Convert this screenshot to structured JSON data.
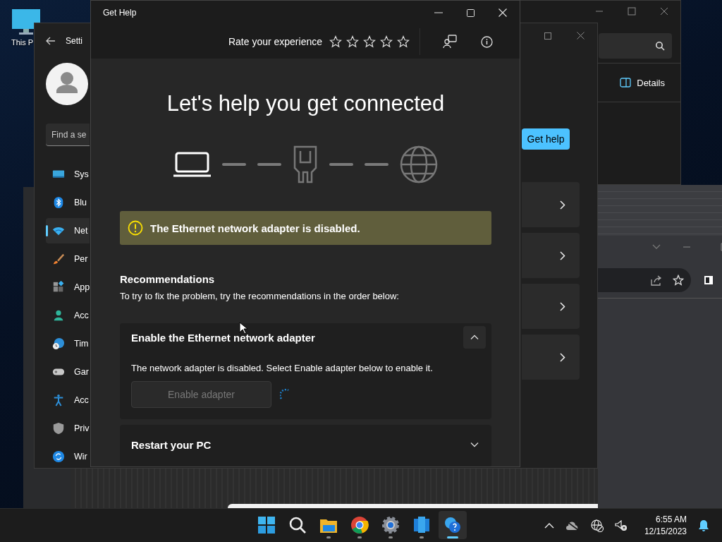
{
  "desktop": {
    "icons": [
      {
        "label": "This P"
      }
    ]
  },
  "explorer_window": {
    "details_button": "Details"
  },
  "settings_window": {
    "title": "Setti",
    "search": {
      "placeholder": "Find a se"
    },
    "nav": [
      {
        "label": "Sys",
        "kind": "system",
        "selected": false
      },
      {
        "label": "Blu",
        "kind": "bluetooth",
        "selected": false
      },
      {
        "label": "Net",
        "kind": "network",
        "selected": true
      },
      {
        "label": "Per",
        "kind": "personalize",
        "selected": false
      },
      {
        "label": "App",
        "kind": "apps",
        "selected": false
      },
      {
        "label": "Acc",
        "kind": "accounts",
        "selected": false
      },
      {
        "label": "Tim",
        "kind": "time",
        "selected": false
      },
      {
        "label": "Gar",
        "kind": "gaming",
        "selected": false
      },
      {
        "label": "Acc",
        "kind": "accessibility",
        "selected": false
      },
      {
        "label": "Priv",
        "kind": "privacy",
        "selected": false
      },
      {
        "label": "Wir",
        "kind": "update",
        "selected": false
      }
    ],
    "get_help_button": "Get help",
    "cards": [
      {
        "kind": "link"
      },
      {
        "kind": "link"
      },
      {
        "kind": "link"
      },
      {
        "kind": "link"
      }
    ]
  },
  "get_help": {
    "title": "Get Help",
    "rating": {
      "label": "Rate your experience",
      "stars": 0
    },
    "heading": "Let's help you get connected",
    "path": [
      {
        "kind": "laptop",
        "on": true
      },
      {
        "kind": "adapter",
        "on": false
      },
      {
        "kind": "internet",
        "on": false
      }
    ],
    "alert": "The Ethernet network adapter is disabled.",
    "recommendations": {
      "title": "Recommendations",
      "intro": "To try to fix the problem, try the recommendations in the order below:",
      "items": [
        {
          "title": "Enable the Ethernet network adapter",
          "expanded": true,
          "description": "The network adapter is disabled. Select Enable adapter below to enable it.",
          "button": {
            "label": "Enable adapter",
            "disabled": true
          },
          "busy": true
        },
        {
          "title": "Restart your PC",
          "expanded": false
        }
      ]
    }
  },
  "taskbar": {
    "apps": [
      {
        "kind": "start",
        "running": false,
        "selected": false
      },
      {
        "kind": "search",
        "running": false,
        "selected": false
      },
      {
        "kind": "files",
        "running": true,
        "selected": false
      },
      {
        "kind": "browser",
        "running": true,
        "selected": false
      },
      {
        "kind": "settings",
        "running": true,
        "selected": false
      },
      {
        "kind": "tablet",
        "running": true,
        "selected": false
      },
      {
        "kind": "help",
        "running": true,
        "selected": true
      }
    ],
    "time": "6:55 AM",
    "date": "12/15/2023"
  }
}
